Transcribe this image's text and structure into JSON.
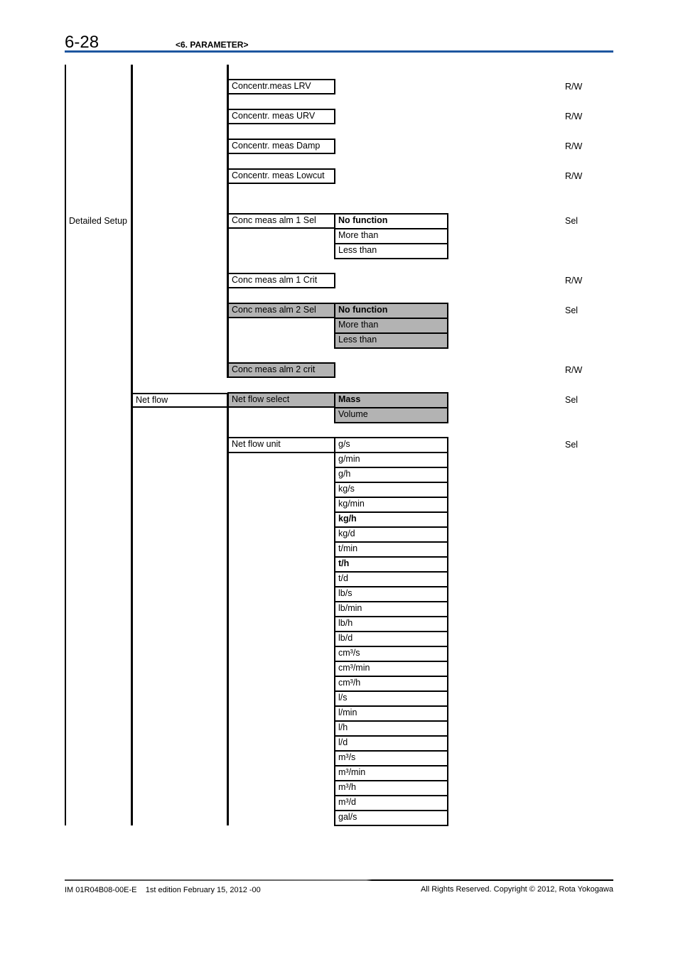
{
  "header": {
    "page_number": "6-28",
    "section_title": "<6. PARAMETER>",
    "accent_color": "#1e56a0"
  },
  "tree": {
    "level1_label": "Detailed Setup",
    "level2_label": "Net flow",
    "concentration_params": [
      {
        "label": "Concentr.meas LRV",
        "access": "R/W"
      },
      {
        "label": "Concentr. meas URV",
        "access": "R/W"
      },
      {
        "label": "Concentr. meas Damp",
        "access": "R/W"
      },
      {
        "label": "Concentr. meas Lowcut",
        "access": "R/W"
      }
    ],
    "alarm1_sel": {
      "label": "Conc meas alm 1 Sel",
      "access": "Sel",
      "options": [
        {
          "label": "No function",
          "default": true
        },
        {
          "label": "More than",
          "default": false
        },
        {
          "label": "Less than",
          "default": false
        }
      ]
    },
    "alarm1_crit": {
      "label": "Conc meas alm 1 Crit",
      "access": "R/W"
    },
    "alarm2_sel": {
      "label": "Conc meas alm 2 Sel",
      "access": "Sel",
      "options": [
        {
          "label": "No function",
          "default": true
        },
        {
          "label": "More than",
          "default": false
        },
        {
          "label": "Less than",
          "default": false
        }
      ]
    },
    "alarm2_crit": {
      "label": "Conc meas alm 2 crit",
      "access": "R/W"
    },
    "net_flow_select": {
      "label": "Net flow select",
      "access": "Sel",
      "options": [
        {
          "label": "Mass",
          "default": true
        },
        {
          "label": "Volume",
          "default": false
        }
      ]
    },
    "net_flow_unit": {
      "label": "Net flow unit",
      "access": "Sel",
      "options": [
        {
          "label": "g/s",
          "default": false
        },
        {
          "label": "g/min",
          "default": false
        },
        {
          "label": "g/h",
          "default": false
        },
        {
          "label": "kg/s",
          "default": false
        },
        {
          "label": "kg/min",
          "default": false
        },
        {
          "label": "kg/h",
          "default": true
        },
        {
          "label": "kg/d",
          "default": false
        },
        {
          "label": "t/min",
          "default": false
        },
        {
          "label": "t/h",
          "default": true
        },
        {
          "label": "t/d",
          "default": false
        },
        {
          "label": "lb/s",
          "default": false
        },
        {
          "label": "lb/min",
          "default": false
        },
        {
          "label": "lb/h",
          "default": false
        },
        {
          "label": "lb/d",
          "default": false
        },
        {
          "label": "cm³/s",
          "default": false
        },
        {
          "label": "cm³/min",
          "default": false
        },
        {
          "label": "cm³/h",
          "default": false
        },
        {
          "label": "l/s",
          "default": false
        },
        {
          "label": "l/min",
          "default": false
        },
        {
          "label": "l/h",
          "default": false
        },
        {
          "label": "l/d",
          "default": false
        },
        {
          "label": "m³/s",
          "default": false
        },
        {
          "label": "m³/min",
          "default": false
        },
        {
          "label": "m³/h",
          "default": false
        },
        {
          "label": "m³/d",
          "default": false
        },
        {
          "label": "gal/s",
          "default": false
        }
      ]
    }
  },
  "footer": {
    "doc_id": "IM 01R04B08-00E-E",
    "edition": "1st edition February 15, 2012 -00",
    "copyright": "All Rights Reserved. Copyright © 2012, Rota Yokogawa"
  }
}
